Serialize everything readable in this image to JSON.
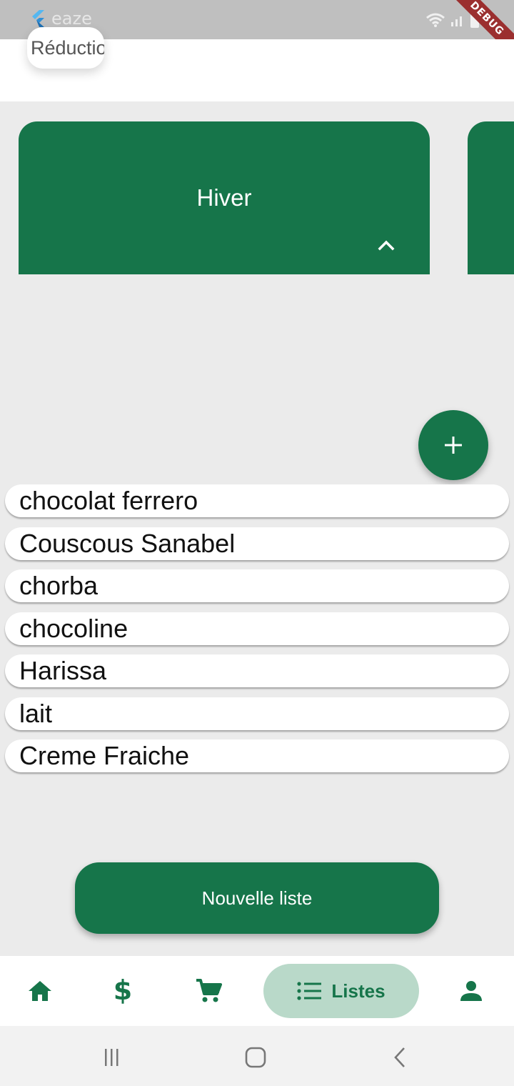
{
  "status_bar": {
    "app_name": "eaze",
    "app_icon": "flutter-icon",
    "icons": [
      "wifi-icon",
      "signal-icon",
      "battery-icon"
    ],
    "debug_banner": "DEBUG"
  },
  "header": {
    "chip_label": "Réduction"
  },
  "cards": [
    {
      "title": "Hiver",
      "expand_icon": "chevron-up-icon"
    }
  ],
  "fab": {
    "icon": "plus-icon"
  },
  "items": [
    "chocolat ferrero",
    "Couscous Sanabel",
    "chorba",
    "chocoline",
    "Harissa",
    "lait",
    "Creme Fraiche"
  ],
  "new_list_button": "Nouvelle liste",
  "bottom_nav": {
    "items": [
      {
        "icon": "home-icon"
      },
      {
        "icon": "dollar-icon"
      },
      {
        "icon": "cart-icon"
      },
      {
        "icon": "list-icon",
        "label": "Listes",
        "active": true
      },
      {
        "icon": "person-icon"
      }
    ]
  },
  "system_nav": [
    "recents-icon",
    "home-circle-icon",
    "back-icon"
  ],
  "colors": {
    "primary": "#16754a",
    "active_nav_bg": "#b9d9c9",
    "background": "#ebebeb"
  }
}
